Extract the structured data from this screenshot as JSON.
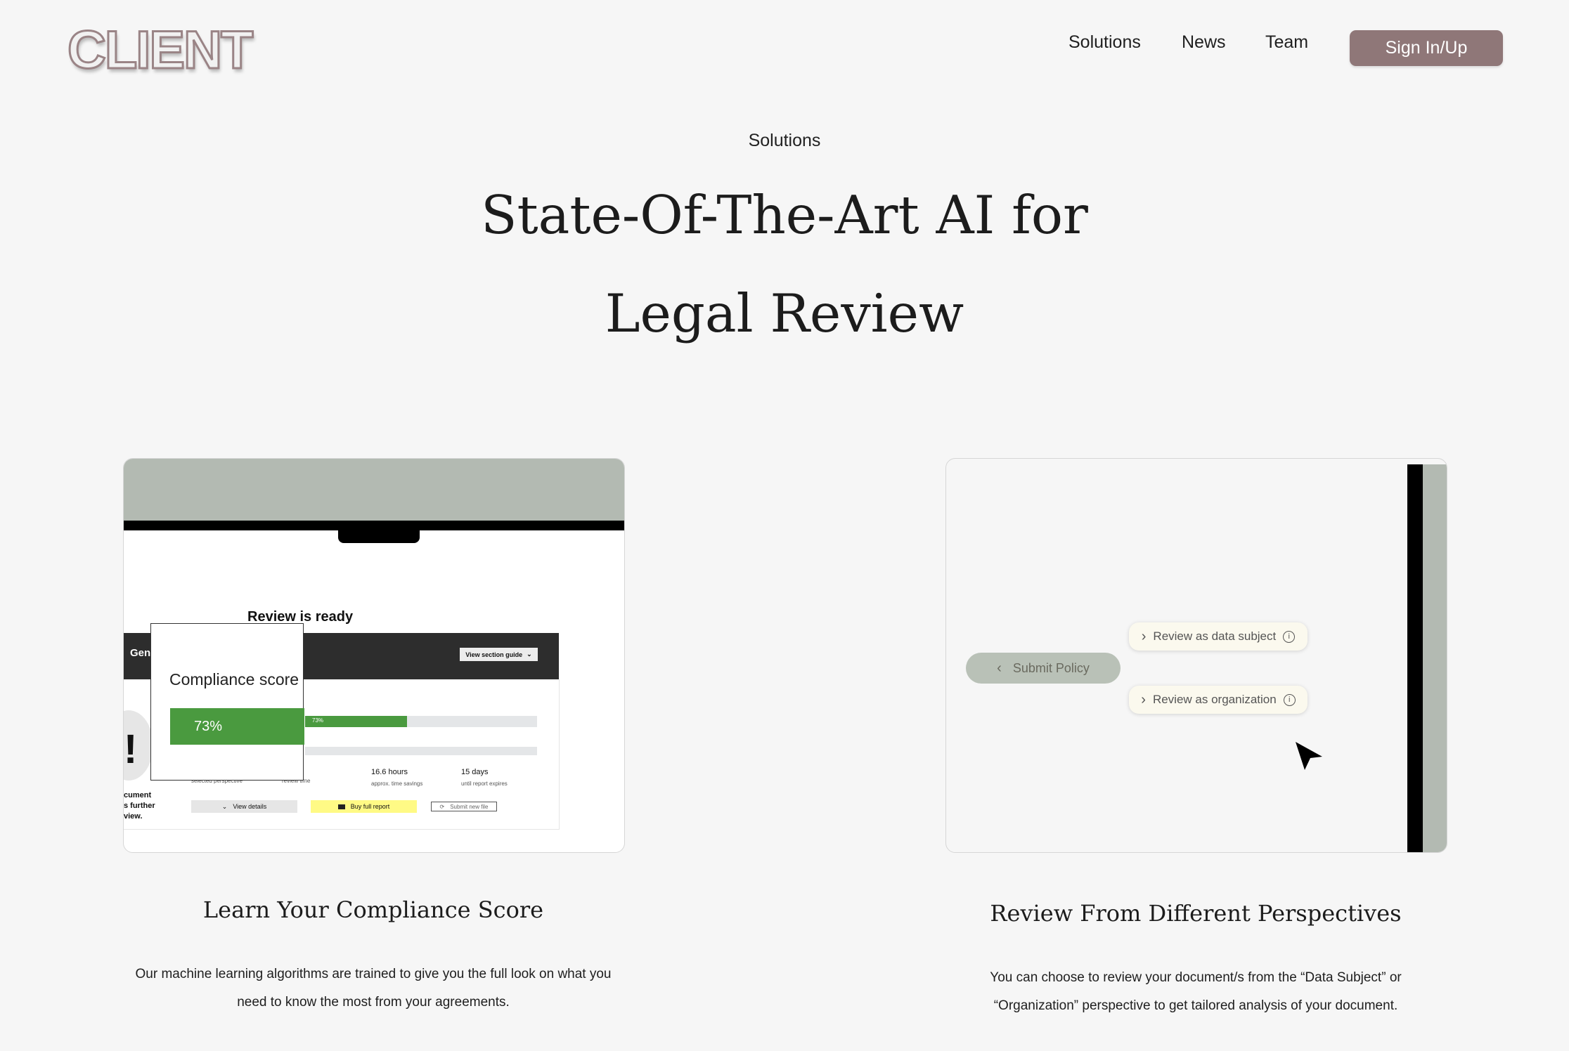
{
  "header": {
    "logo": "CLIENT",
    "nav": [
      "Solutions",
      "News",
      "Team"
    ],
    "signin_label": "Sign In/Up"
  },
  "hero": {
    "eyebrow": "Solutions",
    "title_line1": "State-Of-The-Art AI for",
    "title_line2": "Legal Review"
  },
  "features": [
    {
      "title": "Learn Your Compliance Score",
      "description_line1": "Our machine learning algorithms are trained to give you the full look on what you",
      "description_line2": "need to know the most from your agreements.",
      "mock": {
        "review_ready": "Review is ready",
        "dark_bar_label": "Gen",
        "section_guide": "View section guide",
        "score_label": "Compliance score",
        "score_value": "73%",
        "progress_mini_label": "73%",
        "score_fraction": 0.73,
        "stats": [
          {
            "value": "",
            "label": "selected perspective"
          },
          {
            "value": "",
            "label": "review time"
          },
          {
            "value": "16.6 hours",
            "label": "approx. time savings"
          },
          {
            "value": "15 days",
            "label": "until report expires"
          }
        ],
        "side_text": [
          "cument",
          "s further",
          "view."
        ],
        "buttons": [
          "View details",
          "Buy full report",
          "Submit new file"
        ]
      }
    },
    {
      "title": "Review From Different Perspectives",
      "description_line1": "You can choose to review your document/s from the “Data Subject” or",
      "description_line2": "“Organization” perspective to get tailored analysis of your document.",
      "mock": {
        "submit_label": "Submit Policy",
        "options": [
          "Review as data subject",
          "Review as organization"
        ]
      }
    }
  ],
  "colors": {
    "brand": "#8f7778",
    "background": "#f6f6f6",
    "success": "#4a9a3f",
    "highlight": "#fffa85"
  }
}
